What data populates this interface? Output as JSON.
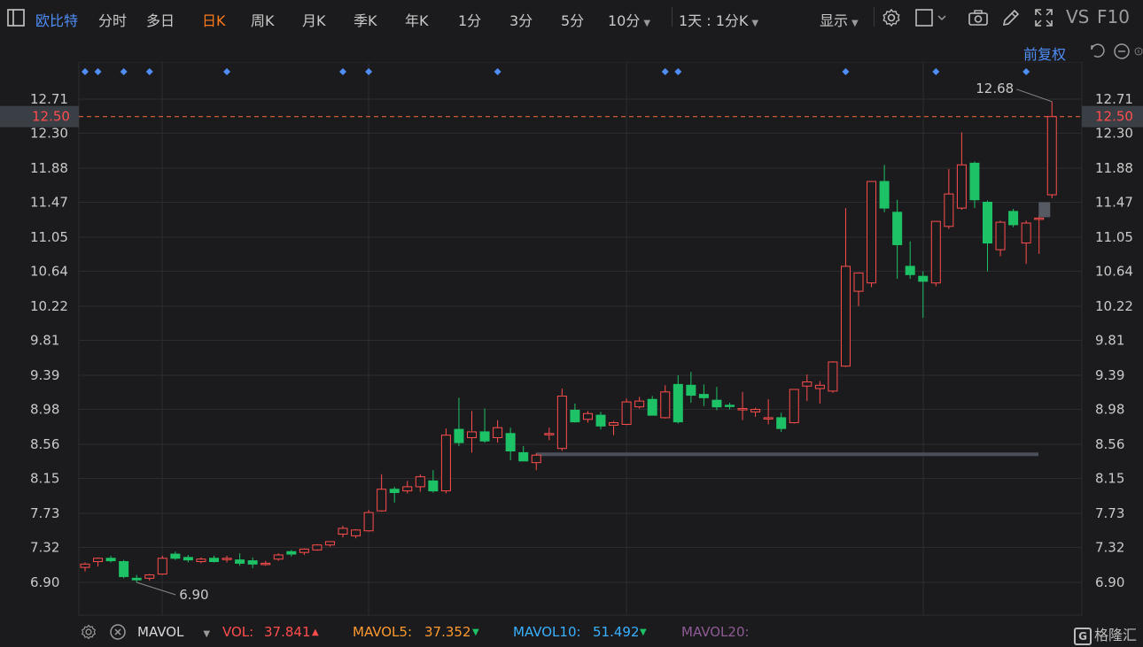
{
  "toolbar": {
    "stock_name": "欧比特",
    "periods": [
      "分时",
      "多日",
      "日K",
      "周K",
      "月K",
      "季K",
      "年K",
      "1分",
      "3分",
      "5分",
      "10分"
    ],
    "active_period": "日K",
    "interval_select": "1天 : 1分K",
    "display_label": "显示",
    "vs_label": "VS",
    "f10_label": "F10",
    "icons": [
      "sidebar-icon",
      "settings-icon",
      "square-icon",
      "camera-icon",
      "pencil-icon",
      "fullscreen-icon"
    ]
  },
  "subbar": {
    "fuquan_label": "前复权",
    "icons": [
      "undo-icon",
      "zoom-out-icon",
      "zoom-in-icon"
    ]
  },
  "colors": {
    "up": "#ff4d4d",
    "down": "#1ec266",
    "background": "#1b1b1d",
    "grid": "#2c2c2f",
    "price_line": "#ff6a3d",
    "event_marker": "#4f8ef7",
    "accent": "#ff7a1a"
  },
  "chart_data": {
    "type": "candlestick",
    "y_ticks": [
      12.71,
      12.3,
      11.88,
      11.47,
      11.05,
      10.64,
      10.22,
      9.81,
      9.39,
      8.98,
      8.56,
      8.15,
      7.73,
      7.32,
      6.9
    ],
    "ylim": [
      6.9,
      12.71
    ],
    "current_price": "12.50",
    "high_annotation": "12.68",
    "low_annotation": "6.90",
    "support_line": 8.44,
    "event_marker_bars": [
      0,
      1,
      3,
      5,
      11,
      20,
      22,
      32,
      45,
      46,
      59,
      66,
      73
    ],
    "candles": [
      {
        "o": 7.08,
        "h": 7.14,
        "l": 7.03,
        "c": 7.12
      },
      {
        "o": 7.15,
        "h": 7.2,
        "l": 7.09,
        "c": 7.19
      },
      {
        "o": 7.19,
        "h": 7.22,
        "l": 7.14,
        "c": 7.16
      },
      {
        "o": 7.15,
        "h": 7.17,
        "l": 6.95,
        "c": 6.97
      },
      {
        "o": 6.95,
        "h": 6.99,
        "l": 6.9,
        "c": 6.93
      },
      {
        "o": 6.95,
        "h": 7.0,
        "l": 6.92,
        "c": 6.99
      },
      {
        "o": 7.0,
        "h": 7.22,
        "l": 6.99,
        "c": 7.19
      },
      {
        "o": 7.24,
        "h": 7.27,
        "l": 7.17,
        "c": 7.19
      },
      {
        "o": 7.2,
        "h": 7.23,
        "l": 7.14,
        "c": 7.17
      },
      {
        "o": 7.15,
        "h": 7.2,
        "l": 7.13,
        "c": 7.18
      },
      {
        "o": 7.19,
        "h": 7.22,
        "l": 7.14,
        "c": 7.15
      },
      {
        "o": 7.18,
        "h": 7.22,
        "l": 7.14,
        "c": 7.19
      },
      {
        "o": 7.17,
        "h": 7.25,
        "l": 7.1,
        "c": 7.13
      },
      {
        "o": 7.16,
        "h": 7.2,
        "l": 7.07,
        "c": 7.12
      },
      {
        "o": 7.12,
        "h": 7.16,
        "l": 7.1,
        "c": 7.13
      },
      {
        "o": 7.18,
        "h": 7.25,
        "l": 7.16,
        "c": 7.23
      },
      {
        "o": 7.27,
        "h": 7.29,
        "l": 7.21,
        "c": 7.24
      },
      {
        "o": 7.26,
        "h": 7.31,
        "l": 7.23,
        "c": 7.3
      },
      {
        "o": 7.29,
        "h": 7.36,
        "l": 7.28,
        "c": 7.35
      },
      {
        "o": 7.35,
        "h": 7.39,
        "l": 7.33,
        "c": 7.39
      },
      {
        "o": 7.48,
        "h": 7.58,
        "l": 7.44,
        "c": 7.55
      },
      {
        "o": 7.46,
        "h": 7.54,
        "l": 7.43,
        "c": 7.53
      },
      {
        "o": 7.52,
        "h": 7.77,
        "l": 7.51,
        "c": 7.74
      },
      {
        "o": 7.76,
        "h": 8.2,
        "l": 7.75,
        "c": 8.02
      },
      {
        "o": 8.02,
        "h": 8.05,
        "l": 7.86,
        "c": 7.98
      },
      {
        "o": 8.0,
        "h": 8.12,
        "l": 7.97,
        "c": 8.05
      },
      {
        "o": 8.05,
        "h": 8.2,
        "l": 7.99,
        "c": 8.17
      },
      {
        "o": 8.12,
        "h": 8.25,
        "l": 7.98,
        "c": 8.0
      },
      {
        "o": 8.0,
        "h": 8.75,
        "l": 7.97,
        "c": 8.67
      },
      {
        "o": 8.74,
        "h": 9.12,
        "l": 8.54,
        "c": 8.58
      },
      {
        "o": 8.64,
        "h": 8.96,
        "l": 8.46,
        "c": 8.71
      },
      {
        "o": 8.71,
        "h": 8.99,
        "l": 8.58,
        "c": 8.6
      },
      {
        "o": 8.64,
        "h": 8.85,
        "l": 8.58,
        "c": 8.76
      },
      {
        "o": 8.69,
        "h": 8.76,
        "l": 8.37,
        "c": 8.48
      },
      {
        "o": 8.46,
        "h": 8.54,
        "l": 8.36,
        "c": 8.36
      },
      {
        "o": 8.34,
        "h": 8.45,
        "l": 8.25,
        "c": 8.43
      },
      {
        "o": 8.68,
        "h": 8.76,
        "l": 8.61,
        "c": 8.69
      },
      {
        "o": 8.51,
        "h": 9.23,
        "l": 8.48,
        "c": 9.14
      },
      {
        "o": 8.97,
        "h": 9.05,
        "l": 8.82,
        "c": 8.83
      },
      {
        "o": 8.86,
        "h": 8.96,
        "l": 8.82,
        "c": 8.93
      },
      {
        "o": 8.91,
        "h": 8.95,
        "l": 8.74,
        "c": 8.78
      },
      {
        "o": 8.79,
        "h": 8.84,
        "l": 8.67,
        "c": 8.82
      },
      {
        "o": 8.8,
        "h": 9.11,
        "l": 8.79,
        "c": 9.07
      },
      {
        "o": 9.01,
        "h": 9.13,
        "l": 8.99,
        "c": 9.08
      },
      {
        "o": 9.1,
        "h": 9.14,
        "l": 8.94,
        "c": 8.91
      },
      {
        "o": 8.88,
        "h": 9.27,
        "l": 8.87,
        "c": 9.19
      },
      {
        "o": 9.28,
        "h": 9.39,
        "l": 8.81,
        "c": 8.83
      },
      {
        "o": 9.27,
        "h": 9.43,
        "l": 9.06,
        "c": 9.15
      },
      {
        "o": 9.16,
        "h": 9.28,
        "l": 9.02,
        "c": 9.12
      },
      {
        "o": 9.09,
        "h": 9.25,
        "l": 8.97,
        "c": 9.01
      },
      {
        "o": 9.03,
        "h": 9.06,
        "l": 8.98,
        "c": 9.02
      },
      {
        "o": 8.98,
        "h": 9.19,
        "l": 8.85,
        "c": 8.99
      },
      {
        "o": 8.95,
        "h": 9.0,
        "l": 8.89,
        "c": 8.98
      },
      {
        "o": 8.88,
        "h": 9.1,
        "l": 8.8,
        "c": 8.88
      },
      {
        "o": 8.88,
        "h": 8.94,
        "l": 8.71,
        "c": 8.75
      },
      {
        "o": 8.82,
        "h": 9.22,
        "l": 8.81,
        "c": 9.22
      },
      {
        "o": 9.26,
        "h": 9.4,
        "l": 9.08,
        "c": 9.31
      },
      {
        "o": 9.23,
        "h": 9.32,
        "l": 9.05,
        "c": 9.27
      },
      {
        "o": 9.2,
        "h": 9.56,
        "l": 9.18,
        "c": 9.55
      },
      {
        "o": 9.5,
        "h": 11.4,
        "l": 9.49,
        "c": 10.7
      },
      {
        "o": 10.4,
        "h": 10.62,
        "l": 10.22,
        "c": 10.62
      },
      {
        "o": 10.5,
        "h": 11.68,
        "l": 10.45,
        "c": 11.72
      },
      {
        "o": 11.72,
        "h": 11.92,
        "l": 11.35,
        "c": 11.4
      },
      {
        "o": 11.35,
        "h": 11.5,
        "l": 10.55,
        "c": 10.96
      },
      {
        "o": 10.7,
        "h": 11.0,
        "l": 10.55,
        "c": 10.6
      },
      {
        "o": 10.58,
        "h": 10.64,
        "l": 10.08,
        "c": 10.52
      },
      {
        "o": 10.5,
        "h": 11.24,
        "l": 10.46,
        "c": 11.24
      },
      {
        "o": 11.18,
        "h": 11.87,
        "l": 11.15,
        "c": 11.57
      },
      {
        "o": 11.4,
        "h": 12.31,
        "l": 11.38,
        "c": 11.92
      },
      {
        "o": 11.94,
        "h": 11.96,
        "l": 11.4,
        "c": 11.5
      },
      {
        "o": 11.47,
        "h": 11.49,
        "l": 10.64,
        "c": 10.98
      },
      {
        "o": 10.9,
        "h": 11.25,
        "l": 10.82,
        "c": 11.23
      },
      {
        "o": 11.36,
        "h": 11.39,
        "l": 11.17,
        "c": 11.2
      },
      {
        "o": 10.98,
        "h": 11.25,
        "l": 10.73,
        "c": 11.22
      },
      {
        "o": 11.28,
        "h": 11.31,
        "l": 10.85,
        "c": 11.28
      },
      {
        "o": 11.56,
        "h": 12.68,
        "l": 11.52,
        "c": 12.5
      }
    ]
  },
  "volume_bar": {
    "settings_icon": "settings-icon",
    "close_icon": "close-icon",
    "indicator_name": "MAVOL",
    "vol_label": "VOL:",
    "vol_value": "37.841",
    "vol_trend": "▲",
    "mavol5_label": "MAVOL5:",
    "mavol5_value": "37.352",
    "mavol5_trend": "▼",
    "mavol10_label": "MAVOL10:",
    "mavol10_value": "51.492",
    "mavol10_trend": "▼",
    "mavol20_label": "MAVOL20:"
  },
  "watermark": "格隆汇"
}
